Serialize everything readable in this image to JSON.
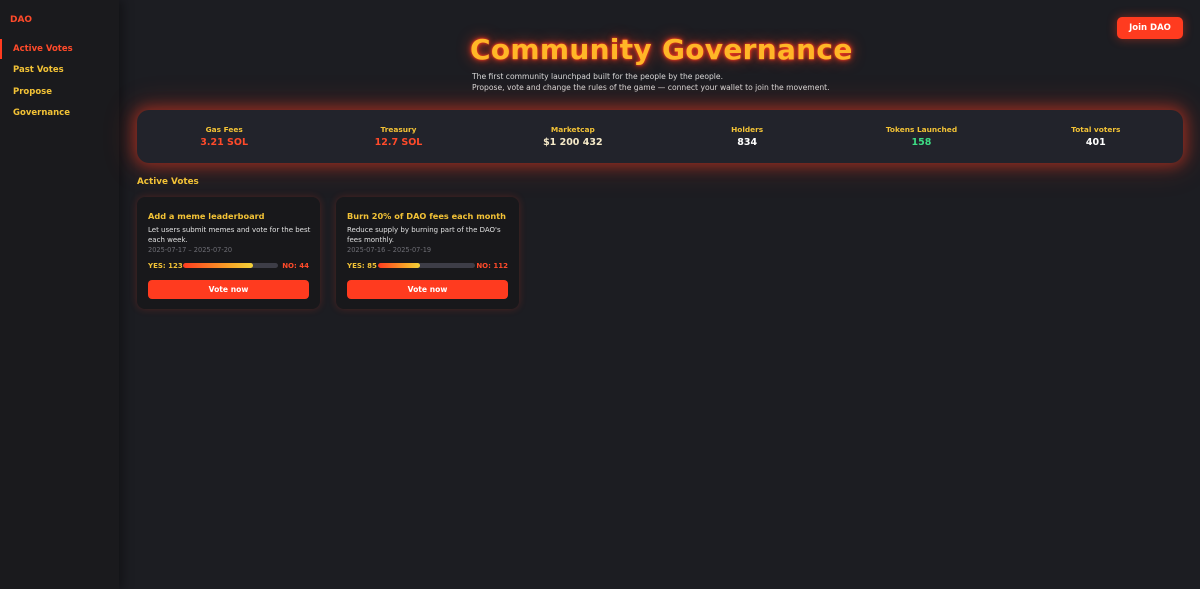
{
  "sidebar": {
    "brand": "DAO",
    "items": [
      {
        "label": "Active Votes",
        "active": true
      },
      {
        "label": "Past Votes",
        "active": false
      },
      {
        "label": "Propose",
        "active": false
      },
      {
        "label": "Governance",
        "active": false
      }
    ]
  },
  "header": {
    "join_label": "Join DAO",
    "title": "Community Governance",
    "subtitle_line1": "The first community launchpad built for the people by the people.",
    "subtitle_line2": "Propose, vote and change the rules of the game — connect your wallet to join the movement."
  },
  "stats": [
    {
      "label": "Gas Fees",
      "value": "3.21 SOL",
      "color": "#ff4a2a"
    },
    {
      "label": "Treasury",
      "value": "12.7 SOL",
      "color": "#ff4a2a"
    },
    {
      "label": "Marketcap",
      "value": "$1 200 432",
      "color": "#f5e9c8"
    },
    {
      "label": "Holders",
      "value": "834",
      "color": "#ffffff"
    },
    {
      "label": "Tokens Launched",
      "value": "158",
      "color": "#3ddc84"
    },
    {
      "label": "Total voters",
      "value": "401",
      "color": "#ffffff"
    }
  ],
  "active_votes": {
    "heading": "Active Votes",
    "cards": [
      {
        "title": "Add a meme leaderboard",
        "description": "Let users submit memes and vote for the best each week.",
        "dates": "2025-07-17 – 2025-07-20",
        "yes_label": "YES: 123",
        "no_label": "NO: 44",
        "yes_fraction": 0.74,
        "button_label": "Vote now"
      },
      {
        "title": "Burn 20% of DAO fees each month",
        "description": "Reduce supply by burning part of the DAO's fees monthly.",
        "dates": "2025-07-16 – 2025-07-19",
        "yes_label": "YES: 85",
        "no_label": "NO: 112",
        "yes_fraction": 0.43,
        "button_label": "Vote now"
      }
    ]
  },
  "colors": {
    "accent": "#ff3b1f",
    "gold": "#f2c236",
    "background": "#1c1d22"
  }
}
